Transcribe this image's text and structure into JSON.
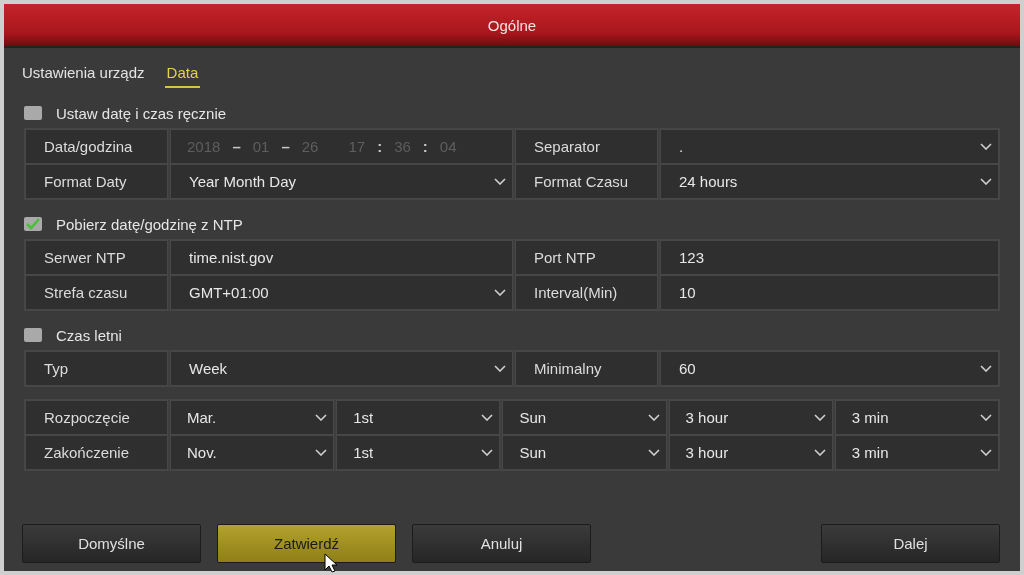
{
  "window": {
    "title": "Ogólne"
  },
  "tabs": [
    {
      "label": "Ustawienia urządz",
      "selected": false
    },
    {
      "label": "Data",
      "selected": true
    }
  ],
  "sections": [
    {
      "checkbox": {
        "label": "Ustaw datę i czas ręcznie",
        "checked": false
      },
      "rows": [
        [
          {
            "label": "Data/godzina",
            "field": {
              "kind": "datetime",
              "disabled": true,
              "parts": [
                "2018",
                "–",
                "01",
                "–",
                "26",
                "17",
                ":",
                "36",
                ":",
                "04"
              ]
            }
          },
          {
            "label": "Separator",
            "field": {
              "kind": "select",
              "value": "."
            }
          }
        ],
        [
          {
            "label": "Format Daty",
            "field": {
              "kind": "select",
              "value": "Year Month Day"
            }
          },
          {
            "label": "Format Czasu",
            "field": {
              "kind": "select",
              "value": "24 hours"
            }
          }
        ]
      ]
    },
    {
      "checkbox": {
        "label": "Pobierz datę/godzinę z NTP",
        "checked": true
      },
      "rows": [
        [
          {
            "label": "Serwer NTP",
            "field": {
              "kind": "input",
              "value": "time.nist.gov"
            }
          },
          {
            "label": "Port NTP",
            "field": {
              "kind": "input",
              "value": "123"
            }
          }
        ],
        [
          {
            "label": "Strefa czasu",
            "field": {
              "kind": "select",
              "value": "GMT+01:00"
            }
          },
          {
            "label": "Interval(Min)",
            "field": {
              "kind": "input",
              "value": "10"
            }
          }
        ]
      ]
    },
    {
      "checkbox": {
        "label": "Czas letni",
        "checked": false
      },
      "rows": [
        [
          {
            "label": "Typ",
            "field": {
              "kind": "select",
              "value": "Week"
            }
          },
          {
            "label": "Minimalny",
            "field": {
              "kind": "select",
              "value": "60"
            }
          }
        ]
      ]
    }
  ],
  "schedule": [
    {
      "label": "Rozpoczęcie",
      "values": [
        "Mar.",
        "1st",
        "Sun",
        "3 hour",
        "3 min"
      ]
    },
    {
      "label": "Zakończenie",
      "values": [
        "Nov.",
        "1st",
        "Sun",
        "3 hour",
        "3 min"
      ]
    }
  ],
  "buttons": [
    {
      "label": "Domyślne",
      "highlighted": false,
      "cursor": false
    },
    {
      "label": "Zatwierdź",
      "highlighted": true,
      "cursor": true
    },
    {
      "label": "Anuluj",
      "highlighted": false,
      "cursor": false
    }
  ],
  "next_button": {
    "label": "Dalej"
  }
}
